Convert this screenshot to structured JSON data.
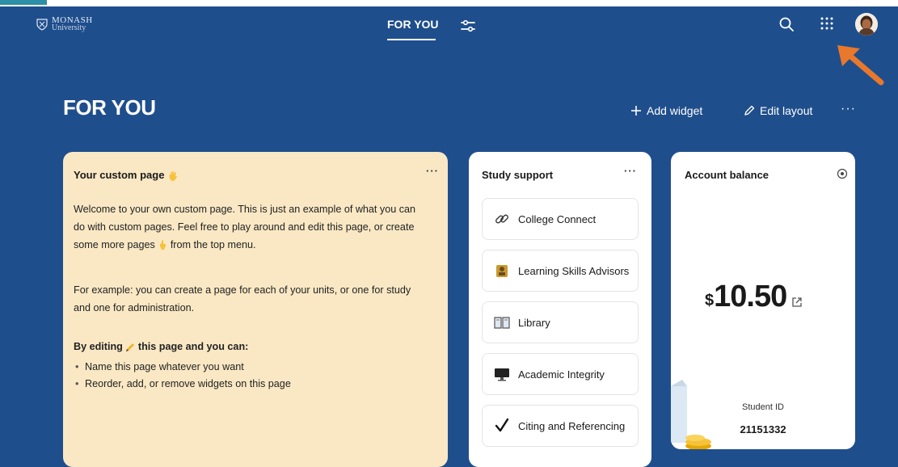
{
  "nav": {
    "tab": "FOR YOU"
  },
  "logo": {
    "line1": "MONASH",
    "line2": "University"
  },
  "page": {
    "title": "FOR YOU",
    "add_widget": "Add widget",
    "edit_layout": "Edit layout",
    "more": "···"
  },
  "custom_card": {
    "title": "Your custom page",
    "more": "···",
    "p1a": "Welcome to your own custom page. This is just an example of what you can",
    "p1b": "do with custom pages. Feel free to play around and edit this page, or create",
    "p1c_before": "some more pages",
    "p1c_after": "from the top menu.",
    "p2a": "For example: you can create a page for each of your units, or one for study",
    "p2b": "and one for administration.",
    "p3_before": "By editing",
    "p3_after": "this page and you can:",
    "bullets": [
      "Name this page whatever you want",
      "Reorder, add, or remove widgets on this page"
    ]
  },
  "study_card": {
    "title": "Study support",
    "more": "···",
    "items": [
      {
        "label": "College Connect",
        "icon": "link-icon"
      },
      {
        "label": "Learning Skills Advisors",
        "icon": "advisor-icon"
      },
      {
        "label": "Library",
        "icon": "book-icon"
      },
      {
        "label": "Academic Integrity",
        "icon": "monitor-icon"
      },
      {
        "label": "Citing and Referencing",
        "icon": "checkmark-icon"
      }
    ]
  },
  "balance_card": {
    "title": "Account balance",
    "currency": "$",
    "amount": "10.50",
    "student_id_label": "Student ID",
    "student_id": "21151332"
  },
  "colors": {
    "app_background": "#1f4e8c",
    "custom_card": "#fae8c4",
    "accent_arrow": "#e8782b"
  }
}
